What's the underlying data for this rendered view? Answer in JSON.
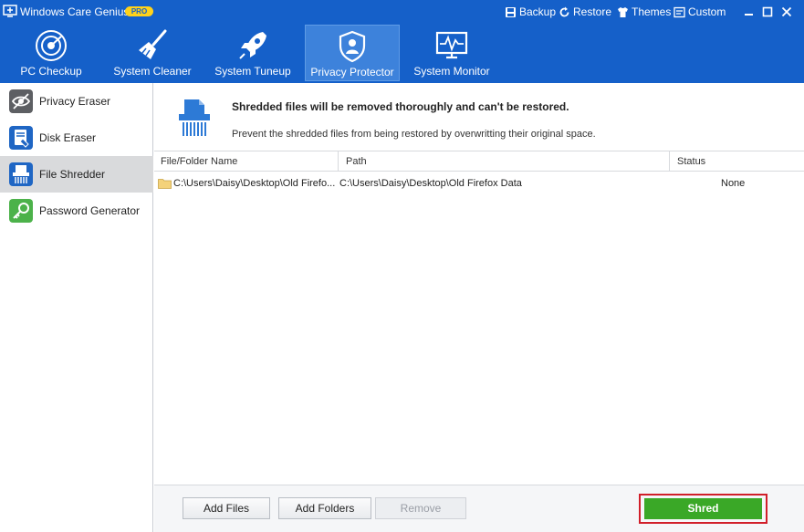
{
  "app": {
    "title": "Windows Care Genius",
    "badge": "PRO",
    "links": [
      {
        "label": "Backup",
        "icon": "backup-icon"
      },
      {
        "label": "Restore",
        "icon": "restore-icon"
      },
      {
        "label": "Themes",
        "icon": "themes-icon"
      },
      {
        "label": "Custom",
        "icon": "custom-icon"
      }
    ]
  },
  "nav": {
    "items": [
      {
        "label": "PC Checkup",
        "icon": "pc-checkup-icon"
      },
      {
        "label": "System Cleaner",
        "icon": "broom-icon"
      },
      {
        "label": "System Tuneup",
        "icon": "rocket-icon"
      },
      {
        "label": "Privacy Protector",
        "icon": "shield-icon",
        "active": true
      },
      {
        "label": "System Monitor",
        "icon": "monitor-icon"
      }
    ]
  },
  "sidebar": {
    "items": [
      {
        "label": "Privacy Eraser",
        "icon": "eye-slash-icon"
      },
      {
        "label": "Disk Eraser",
        "icon": "disk-eraser-icon"
      },
      {
        "label": "File Shredder",
        "icon": "shredder-icon",
        "active": true
      },
      {
        "label": "Password Generator",
        "icon": "key-icon"
      }
    ]
  },
  "main": {
    "title": "Shredded files will be removed thoroughly and can't be restored.",
    "subtitle": "Prevent the shredded files from being restored by overwritting their original space.",
    "columns": [
      "File/Folder Name",
      "Path",
      "Status"
    ],
    "rows": [
      {
        "name": "C:\\Users\\Daisy\\Desktop\\Old Firefo...",
        "path": "C:\\Users\\Daisy\\Desktop\\Old Firefox Data",
        "status": "None"
      }
    ],
    "buttons": {
      "add_files": "Add Files",
      "add_folders": "Add Folders",
      "remove": "Remove",
      "shred": "Shred"
    }
  },
  "colors": {
    "header_blue": "#1560c9",
    "active_nav": "#3d82db",
    "shred_green": "#3aa827",
    "highlight_red": "#d11f2a"
  }
}
